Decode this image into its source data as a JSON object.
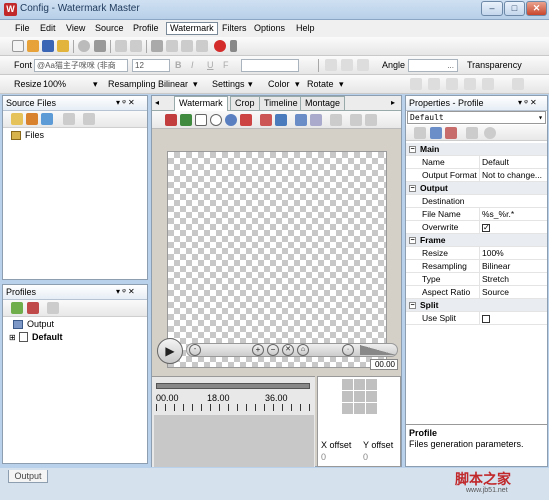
{
  "window": {
    "title": "Config - Watermark Master",
    "min": "–",
    "max": "□",
    "close": "✕"
  },
  "menu": [
    "File",
    "Edit",
    "View",
    "Source",
    "Profile",
    "Watermark",
    "Filters",
    "Options",
    "Help"
  ],
  "format_toolbar": {
    "font_label": "Font",
    "font_value": "@Aa猫主子咪咪 (非商",
    "size_value": "12",
    "angle_label": "Angle",
    "angle_value": "...",
    "transparency_label": "Transparency"
  },
  "image_toolbar": {
    "resize_label": "Resize",
    "resize_value": "100%",
    "resampling_label": "Resampling",
    "resampling_value": "Bilinear",
    "settings_label": "Settings",
    "color_label": "Color",
    "rotate_label": "Rotate"
  },
  "source_files": {
    "header": "Source Files",
    "items": [
      "Files"
    ]
  },
  "profiles": {
    "header": "Profiles",
    "items": [
      "Output",
      "Default"
    ]
  },
  "editor": {
    "tabs": [
      "Watermark",
      "Crop",
      "Timeline",
      "Montage"
    ],
    "active_tab": "Watermark",
    "time_display": "00.00",
    "timeline_ticks": [
      "00.00",
      "18.00",
      "36.00"
    ],
    "x_offset_label": "X offset",
    "y_offset_label": "Y offset",
    "x_offset_value": "0",
    "y_offset_value": "0"
  },
  "properties": {
    "header": "Properties - Profile",
    "selector": "Default",
    "categories": [
      {
        "name": "Main",
        "rows": [
          {
            "name": "Name",
            "value": "Default"
          },
          {
            "name": "Output Format",
            "value": "Not to change..."
          }
        ]
      },
      {
        "name": "Output",
        "rows": [
          {
            "name": "Destination",
            "value": ""
          },
          {
            "name": "File Name",
            "value": "%s_%r.*"
          },
          {
            "name": "Overwrite",
            "value": "checked"
          }
        ]
      },
      {
        "name": "Frame",
        "rows": [
          {
            "name": "Resize",
            "value": "100%"
          },
          {
            "name": "Resampling",
            "value": "Bilinear"
          },
          {
            "name": "Type",
            "value": "Stretch"
          },
          {
            "name": "Aspect Ratio",
            "value": "Source"
          }
        ]
      },
      {
        "name": "Split",
        "rows": [
          {
            "name": "Use Split",
            "value": "unchecked"
          }
        ]
      }
    ]
  },
  "help": {
    "title": "Profile",
    "text": "Files generation parameters."
  },
  "bottom_tab": "Output",
  "watermark_logo": {
    "text": "脚本之家",
    "url": "www.jb51.net"
  }
}
